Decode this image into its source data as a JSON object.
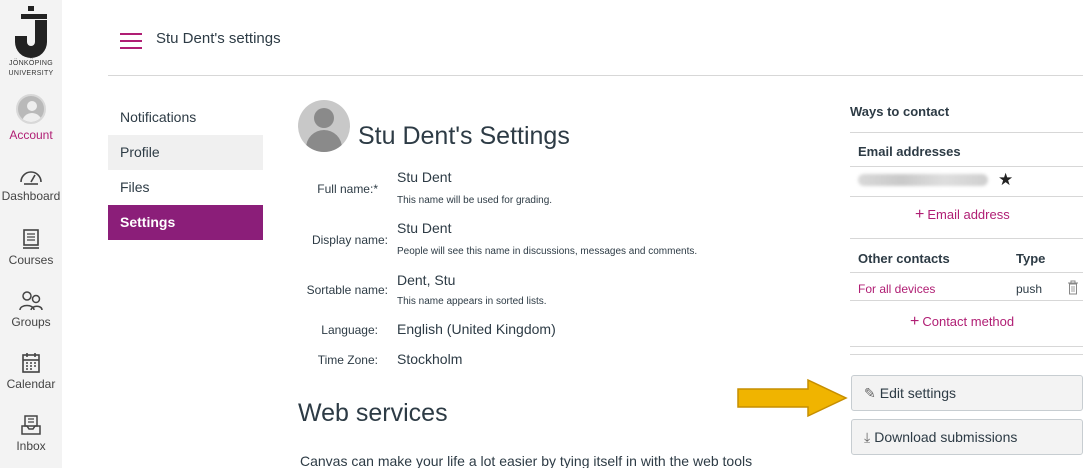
{
  "logo": {
    "line1": "JÖNKÖPING",
    "line2": "UNIVERSITY"
  },
  "nav": {
    "account": "Account",
    "dashboard": "Dashboard",
    "courses": "Courses",
    "groups": "Groups",
    "calendar": "Calendar",
    "inbox": "Inbox"
  },
  "header": {
    "breadcrumb": "Stu Dent's settings"
  },
  "left_menu": {
    "items": [
      {
        "label": "Notifications"
      },
      {
        "label": "Profile"
      },
      {
        "label": "Files"
      },
      {
        "label": "Settings"
      }
    ]
  },
  "main": {
    "title": "Stu Dent's Settings",
    "full_name": {
      "label": "Full name:*",
      "value": "Stu Dent",
      "hint": "This name will be used for grading."
    },
    "display_name": {
      "label": "Display name:",
      "value": "Stu Dent",
      "hint": "People will see this name in discussions, messages and comments."
    },
    "sortable_name": {
      "label": "Sortable name:",
      "value": "Dent, Stu",
      "hint": "This name appears in sorted lists."
    },
    "language": {
      "label": "Language:",
      "value": "English (United Kingdom)"
    },
    "time_zone": {
      "label": "Time Zone:",
      "value": "Stockholm"
    },
    "web_services_title": "Web services",
    "web_services_text": "Canvas can make your life a lot easier by tying itself in with the web tools"
  },
  "sidebar": {
    "ways_to_contact": "Ways to contact",
    "email_addresses": "Email addresses",
    "add_email": "Email address",
    "other_contacts": "Other contacts",
    "type_header": "Type",
    "contact_row": {
      "name": "For all devices",
      "type": "push"
    },
    "add_contact": "Contact method",
    "edit_settings": "Edit settings",
    "download_submissions": "Download submissions"
  },
  "colors": {
    "accent": "#b01e74",
    "active_menu": "#8b1e79",
    "arrow": "#f0b400"
  },
  "icons": [
    "hamburger-icon",
    "account-avatar",
    "dashboard-icon",
    "courses-icon",
    "groups-icon",
    "calendar-icon",
    "inbox-icon",
    "star-icon",
    "trash-icon",
    "pencil-icon",
    "download-icon",
    "arrow-icon"
  ]
}
